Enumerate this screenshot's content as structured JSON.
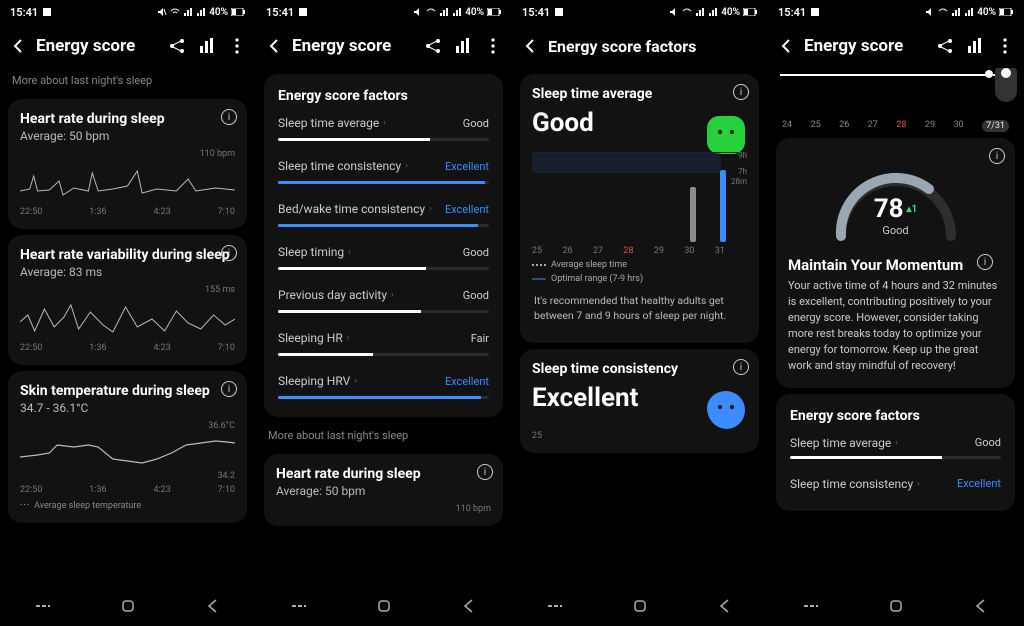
{
  "status": {
    "time": "15:41",
    "battery": "40%"
  },
  "header": {
    "title_energy": "Energy score",
    "title_factors": "Energy score factors"
  },
  "p1": {
    "more_label": "More about last night's sleep",
    "hr_title": "Heart rate during sleep",
    "hr_sub": "Average: 50 bpm",
    "hr_peak": "110 bpm",
    "hrv_title": "Heart rate variability during sleep",
    "hrv_sub": "Average: 83 ms",
    "hrv_peak": "155 ms",
    "temp_title": "Skin temperature during sleep",
    "temp_sub": "34.7 - 36.1°C",
    "temp_hi": "36.6°C",
    "temp_lo": "34.2",
    "xticks": [
      "22:50",
      "1:36",
      "4:23",
      "7:10"
    ],
    "legend": "Average sleep temperature"
  },
  "p2": {
    "title": "Energy score factors",
    "factors": [
      {
        "name": "Sleep time average",
        "rating": "Good",
        "cls": "good",
        "fill": 72
      },
      {
        "name": "Sleep time consistency",
        "rating": "Excellent",
        "cls": "excellent",
        "fill": 98
      },
      {
        "name": "Bed/wake time consistency",
        "rating": "Excellent",
        "cls": "excellent",
        "fill": 95
      },
      {
        "name": "Sleep timing",
        "rating": "Good",
        "cls": "good",
        "fill": 70
      },
      {
        "name": "Previous day activity",
        "rating": "Good",
        "cls": "good",
        "fill": 68
      },
      {
        "name": "Sleeping HR",
        "rating": "Fair",
        "cls": "fair",
        "fill": 45
      },
      {
        "name": "Sleeping HRV",
        "rating": "Excellent",
        "cls": "excellent",
        "fill": 96
      }
    ],
    "more_label": "More about last night's sleep",
    "hr_title": "Heart rate during sleep",
    "hr_sub": "Average: 50 bpm",
    "hr_peak": "110 bpm"
  },
  "p3": {
    "card1_title": "Sleep time average",
    "card1_rating": "Good",
    "y_top": "9h",
    "y_mid": "7h",
    "y_mid2": "28m",
    "xticks": [
      "25",
      "26",
      "27",
      "28",
      "29",
      "30",
      "31"
    ],
    "legend1": "Average sleep time",
    "legend2": "Optimal range (7-9 hrs)",
    "rec": "It's recommended that healthy adults get between 7 and 9 hours of sleep per night.",
    "card2_title": "Sleep time consistency",
    "card2_rating": "Excellent",
    "card2_y": "25"
  },
  "p4": {
    "max": "100",
    "dates": [
      "24",
      "25",
      "26",
      "27",
      "28",
      "29",
      "30",
      "7/31"
    ],
    "highlight_idx": 4,
    "score": "78",
    "delta": "▴1",
    "score_label": "Good",
    "advice_title": "Maintain Your Momentum",
    "advice_text": "Your active time of 4 hours and 32 minutes is excellent, contributing positively to your energy score. However, consider taking more rest breaks today to optimize your energy for tomorrow. Keep up the great work and stay mindful of recovery!",
    "factors_title": "Energy score factors",
    "f1_name": "Sleep time average",
    "f1_rating": "Good",
    "f2_name": "Sleep time consistency",
    "f2_rating": "Excellent"
  },
  "chart_data": [
    {
      "type": "line",
      "title": "Heart rate during sleep",
      "ylabel": "bpm",
      "ylim": [
        40,
        110
      ],
      "x": [
        "22:50",
        "1:36",
        "4:23",
        "7:10"
      ],
      "values": [
        55,
        52,
        60,
        50,
        58,
        48,
        65,
        70,
        52,
        55,
        50,
        53
      ],
      "average": 50,
      "peak": 110
    },
    {
      "type": "line",
      "title": "Heart rate variability during sleep",
      "ylabel": "ms",
      "ylim": [
        30,
        155
      ],
      "x": [
        "22:50",
        "1:36",
        "4:23",
        "7:10"
      ],
      "values": [
        70,
        95,
        60,
        110,
        80,
        120,
        65,
        90,
        85,
        100,
        75,
        88
      ],
      "average": 83,
      "peak": 155
    },
    {
      "type": "line",
      "title": "Skin temperature during sleep",
      "ylabel": "°C",
      "ylim": [
        34.2,
        36.6
      ],
      "x": [
        "22:50",
        "1:36",
        "4:23",
        "7:10"
      ],
      "values": [
        35.1,
        34.9,
        35.6,
        35.8,
        35.7,
        35.3,
        35.0,
        34.7,
        35.2,
        35.9,
        36.1,
        36.0
      ],
      "range": [
        34.7,
        36.1
      ]
    },
    {
      "type": "bar",
      "title": "Sleep time average",
      "ylabel": "hours",
      "ylim": [
        0,
        9
      ],
      "categories": [
        "25",
        "26",
        "27",
        "28",
        "29",
        "30",
        "31"
      ],
      "values": [
        null,
        null,
        null,
        null,
        null,
        6.5,
        7.47
      ],
      "optimal_range": [
        7,
        9
      ],
      "highlight": "31"
    }
  ]
}
